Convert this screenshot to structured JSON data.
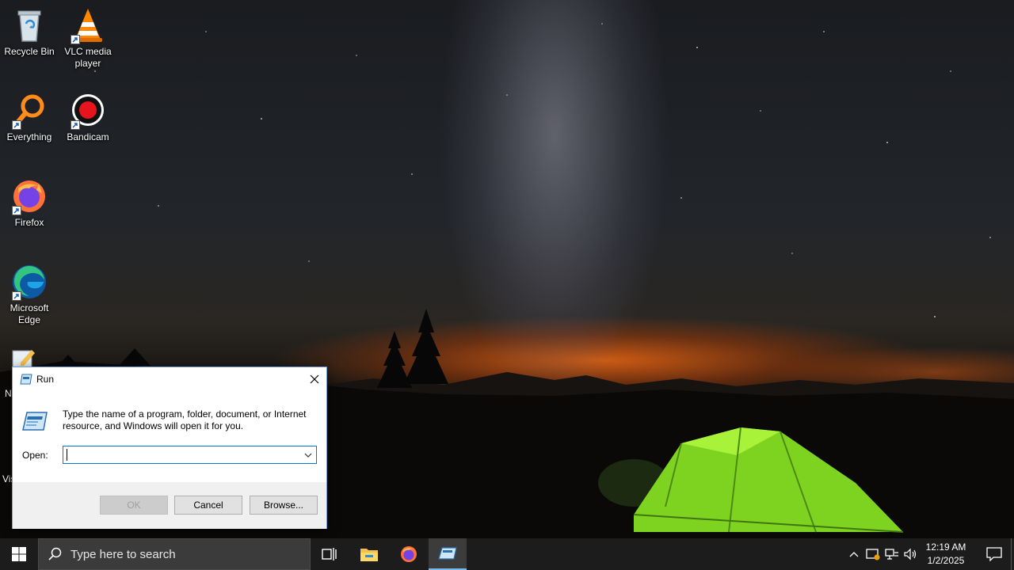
{
  "desktop": {
    "icons": [
      {
        "label": "Recycle Bin",
        "icon": "recycle-bin-icon"
      },
      {
        "label": "VLC media player",
        "icon": "vlc-icon"
      },
      {
        "label": "Everything",
        "icon": "everything-search-icon"
      },
      {
        "label": "Bandicam",
        "icon": "bandicam-icon"
      },
      {
        "label": "Firefox",
        "icon": "firefox-icon"
      },
      {
        "label": "Microsoft Edge",
        "icon": "edge-icon"
      }
    ],
    "partial_labels": [
      "N",
      "Vis"
    ]
  },
  "run_dialog": {
    "title": "Run",
    "message": "Type the name of a program, folder, document, or Internet resource, and Windows will open it for you.",
    "open_label": "Open:",
    "open_value": "",
    "ok_label": "OK",
    "cancel_label": "Cancel",
    "browse_label": "Browse..."
  },
  "taskbar": {
    "search_placeholder": "Type here to search",
    "time": "12:19 AM",
    "date": "1/2/2025"
  },
  "colors": {
    "accent": "#0078d7",
    "taskbar": "#1c1c1c",
    "active_indicator": "#76b9ed"
  }
}
